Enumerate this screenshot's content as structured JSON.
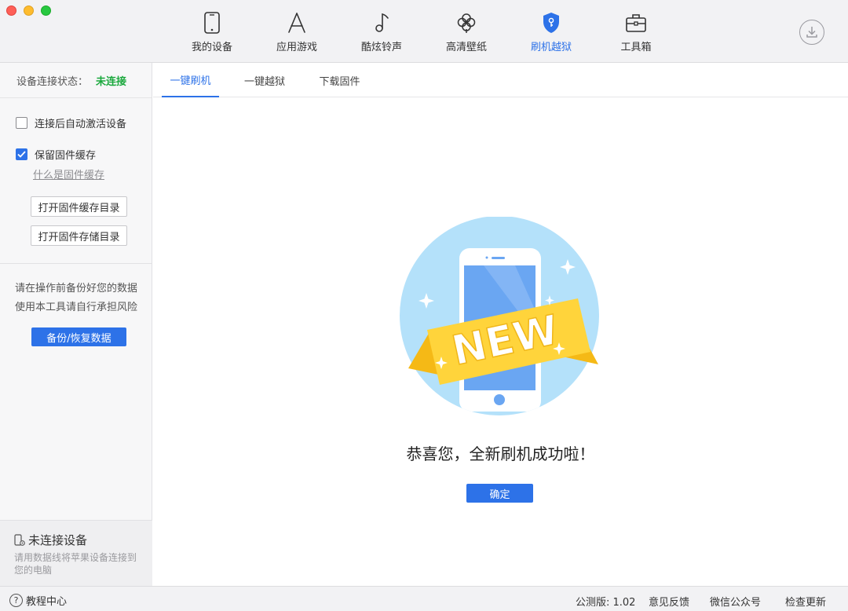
{
  "nav": {
    "items": [
      {
        "label": "我的设备",
        "icon": "phone-icon"
      },
      {
        "label": "应用游戏",
        "icon": "app-store-icon"
      },
      {
        "label": "酷炫铃声",
        "icon": "music-note-icon"
      },
      {
        "label": "高清壁纸",
        "icon": "flower-icon"
      },
      {
        "label": "刷机越狱",
        "icon": "shield-icon"
      },
      {
        "label": "工具箱",
        "icon": "toolbox-icon"
      }
    ],
    "active_index": 4
  },
  "sidebar": {
    "status_label": "设备连接状态：",
    "status_value": "未连接",
    "auto_activate_label": "连接后自动激活设备",
    "auto_activate_checked": false,
    "keep_cache_label": "保留固件缓存",
    "keep_cache_checked": true,
    "what_is_cache": "什么是固件缓存",
    "open_cache_dir": "打开固件缓存目录",
    "open_storage_dir": "打开固件存储目录",
    "warning_line1": "请在操作前备份好您的数据",
    "warning_line2": "使用本工具请自行承担风险",
    "backup_button": "备份/恢复数据",
    "device_title": "未连接设备",
    "device_hint": "请用数据线将苹果设备连接到您的电脑"
  },
  "main": {
    "tabs": [
      "一键刷机",
      "一键越狱",
      "下载固件"
    ],
    "active_tab": 0,
    "badge_text": "NEW",
    "congrats": "恭喜您，全新刷机成功啦！",
    "ok_button": "确定"
  },
  "statusbar": {
    "help": "教程中心",
    "version": "公测版: 1.02",
    "feedback": "意见反馈",
    "wechat": "微信公众号",
    "update": "检查更新"
  },
  "colors": {
    "accent": "#2d72e8",
    "status_green": "#19a83c",
    "illus_circle": "#b4e1fa",
    "ribbon": "#ffd43b"
  }
}
